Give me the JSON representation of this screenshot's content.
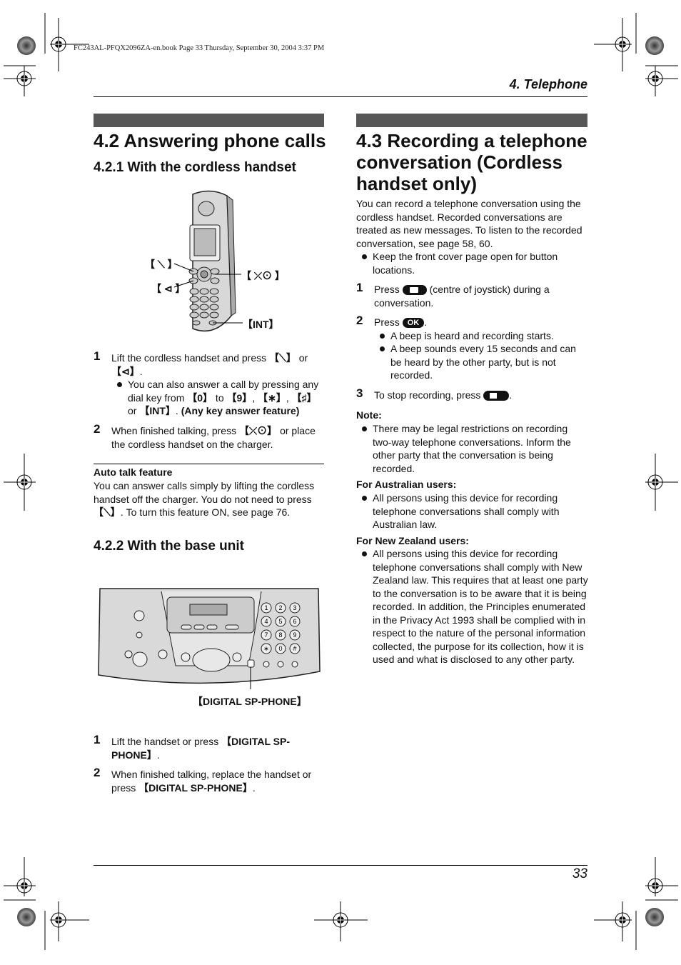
{
  "header": {
    "book_info": "FC243AL-PFQX2096ZA-en.book  Page 33  Thursday, September 30, 2004  3:37 PM",
    "chapter": "4. Telephone"
  },
  "footer": {
    "page_number": "33"
  },
  "left": {
    "title": "4.2 Answering phone calls",
    "sub1": {
      "title": "4.2.1 With the cordless handset",
      "callouts": {
        "talk": "【 ⟍ 】",
        "speaker": "【 ⊲ 】",
        "off": "【 ⤫⊙ 】",
        "int": "【INT】"
      },
      "steps": [
        {
          "num": "1",
          "text_a": "Lift the cordless handset and press ",
          "key_talk": "【⟍】",
          "text_b": " or ",
          "key_sp": "【⊲】",
          "text_c": ".",
          "bullet_a": "You can also answer a call by pressing any dial key from ",
          "k0": "【0】",
          "to": " to ",
          "k9": "【9】",
          "c1": ", ",
          "kstar": "【∗】",
          "c2": ", ",
          "khash": "【♯】",
          "or": " or ",
          "kint": "【INT】",
          "dot": ". ",
          "feature": "(Any key answer feature)"
        },
        {
          "num": "2",
          "text_a": "When finished talking, press ",
          "key_off": "【⤫⊙】",
          "text_b": " or place the cordless handset on the charger."
        }
      ]
    },
    "auto_talk": {
      "title": "Auto talk feature",
      "text_a": "You can answer calls simply by lifting the cordless handset off the charger. You do not need to press ",
      "key": "【⟍】",
      "text_b": ". To turn this feature ON, see page 76."
    },
    "sub2": {
      "title": "4.2.2 With the base unit",
      "callout": "【DIGITAL SP-PHONE】",
      "keypad": [
        "1",
        "2",
        "3",
        "4",
        "5",
        "6",
        "7",
        "8",
        "9",
        "∗",
        "0",
        "#"
      ],
      "steps": [
        {
          "num": "1",
          "text_a": "Lift the handset or press ",
          "key": "【DIGITAL SP-PHONE】",
          "text_b": "."
        },
        {
          "num": "2",
          "text_a": "When finished talking, replace the handset or press ",
          "key": "【DIGITAL SP-PHONE】",
          "text_b": "."
        }
      ]
    }
  },
  "right": {
    "title": "4.3 Recording a telephone conversation (Cordless handset only)",
    "intro": "You can record a telephone conversation using the cordless handset. Recorded conversations are treated as new messages. To listen to the recorded conversation, see page 58, 60.",
    "intro_bullet": "Keep the front cover page open for button locations.",
    "steps": [
      {
        "num": "1",
        "text_a": "Press ",
        "text_b": " (centre of joystick) during a conversation."
      },
      {
        "num": "2",
        "text_a": "Press ",
        "ok": "OK",
        "text_b": ".",
        "bullets": [
          "A beep is heard and recording starts.",
          "A beep sounds every 15 seconds and can be heard by the other party, but is not recorded."
        ]
      },
      {
        "num": "3",
        "text_a": "To stop recording, press ",
        "text_b": "."
      }
    ],
    "note": {
      "title": "Note:",
      "bullet": "There may be legal restrictions on recording two-way telephone conversations. Inform the other party that the conversation is being recorded."
    },
    "australia": {
      "title": "For Australian users:",
      "bullet": "All persons using this device for recording telephone conversations shall comply with Australian law."
    },
    "nz": {
      "title": "For New Zealand users:",
      "bullet": "All persons using this device for recording telephone conversations shall comply with New Zealand law. This requires that at least one party to the conversation is to be aware that it is being recorded. In addition, the Principles enumerated in the Privacy Act 1993 shall be complied with in respect to the nature of the personal information collected, the purpose for its collection, how it is used and what is disclosed to any other party."
    }
  }
}
